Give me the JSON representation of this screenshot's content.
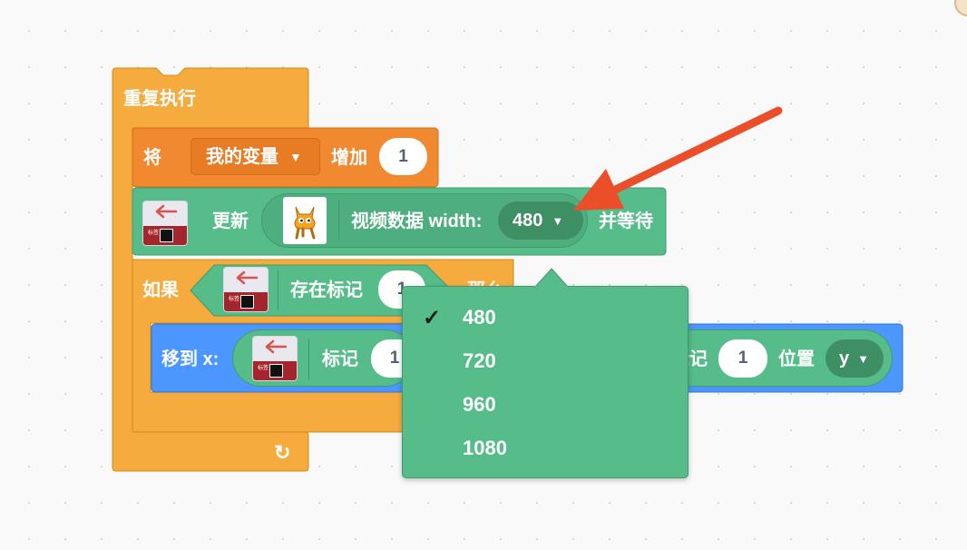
{
  "forever_block": {
    "label": "重复执行",
    "loop_icon": "loop-arrow-icon"
  },
  "change_block": {
    "label_prefix": "将",
    "variable": "我的变量",
    "label_mid": "增加",
    "value": "1"
  },
  "update_block": {
    "label": "更新",
    "video_label": "视频数据 width:",
    "width_value": "480",
    "label_suffix": "并等待"
  },
  "if_block": {
    "label": "如果",
    "condition_label": "存在标记",
    "condition_value": "1",
    "then_partial": "那么"
  },
  "goto_block": {
    "label": "移到 x:",
    "marker_label": "标记",
    "marker_value": "1",
    "marker_label2": "标记",
    "marker_value2": "1",
    "position_label": "位置",
    "axis_value": "y"
  },
  "dropdown_menu": {
    "selected": "480",
    "options": [
      "480",
      "720",
      "960",
      "1080"
    ]
  },
  "marker_icon": {
    "mini_text": "标签"
  },
  "colors": {
    "control": "#f5ab3d",
    "variable": "#f0892f",
    "extension": "#55bc8a",
    "motion": "#4c97ff",
    "arrow": "#ea4f2a"
  }
}
